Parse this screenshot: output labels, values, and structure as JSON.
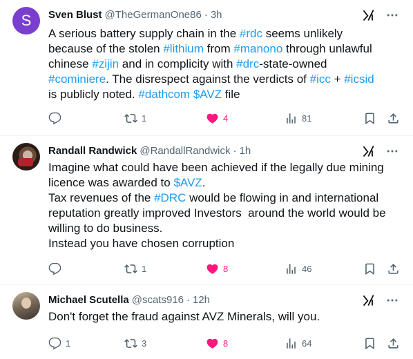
{
  "tweets": [
    {
      "name": "Sven Blust",
      "handle": "@TheGermanOne86",
      "time": "3h",
      "avatar_letter": "S",
      "text_segments": [
        {
          "t": "A serious battery supply chain in the ",
          "link": false
        },
        {
          "t": "#rdc",
          "link": true
        },
        {
          "t": " seems unlikely\nbecause of the stolen ",
          "link": false
        },
        {
          "t": "#lithium",
          "link": true
        },
        {
          "t": " from ",
          "link": false
        },
        {
          "t": "#manono",
          "link": true
        },
        {
          "t": " through unlawful\nchinese ",
          "link": false
        },
        {
          "t": "#zijin",
          "link": true
        },
        {
          "t": " and in complicity with ",
          "link": false
        },
        {
          "t": "#drc",
          "link": true
        },
        {
          "t": "-state-owned\n",
          "link": false
        },
        {
          "t": "#cominiere",
          "link": true
        },
        {
          "t": ". The disrespect against the verdicts of ",
          "link": false
        },
        {
          "t": "#icc",
          "link": true
        },
        {
          "t": " + ",
          "link": false
        },
        {
          "t": "#icsid",
          "link": true
        },
        {
          "t": "\nis publicly noted. ",
          "link": false
        },
        {
          "t": "#dathcom",
          "link": true
        },
        {
          "t": " ",
          "link": false
        },
        {
          "t": "$AVZ",
          "link": true
        },
        {
          "t": " file",
          "link": false
        }
      ],
      "replies": "",
      "retweets": "1",
      "likes": "4",
      "views": "81",
      "liked": true
    },
    {
      "name": "Randall Randwick",
      "handle": "@RandallRandwick",
      "time": "1h",
      "text_segments": [
        {
          "t": "Imagine what could have been achieved if the legally due mining\nlicence was awarded to ",
          "link": false
        },
        {
          "t": "$AVZ",
          "link": true
        },
        {
          "t": ".\nTax revenues of the ",
          "link": false
        },
        {
          "t": "#DRC",
          "link": true
        },
        {
          "t": " would be flowing in and international\nreputation greatly improved Investors  around the world would be\nwilling to do business.\nInstead you have chosen corruption",
          "link": false
        }
      ],
      "replies": "",
      "retweets": "1",
      "likes": "8",
      "views": "46",
      "liked": true
    },
    {
      "name": "Michael Scutella",
      "handle": "@scats916",
      "time": "12h",
      "text_segments": [
        {
          "t": "Don't forget the fraud against AVZ Minerals, will you.",
          "link": false
        }
      ],
      "replies": "1",
      "retweets": "3",
      "likes": "8",
      "views": "64",
      "liked": true
    }
  ],
  "icons": {
    "reply": "reply-icon",
    "retweet": "retweet-icon",
    "like": "heart-icon",
    "views": "views-icon",
    "bookmark": "bookmark-icon",
    "share": "share-icon",
    "grok": "grok-icon",
    "more": "more-icon"
  },
  "colors": {
    "link": "#1d9bf0",
    "liked": "#f91880",
    "muted": "#536471",
    "text": "#0f1419",
    "avatar_letter_bg": "#7b3fd0"
  }
}
